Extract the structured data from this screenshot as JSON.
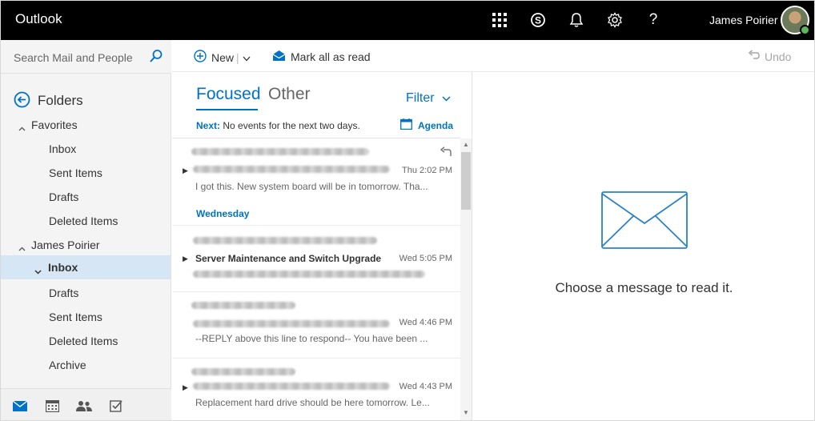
{
  "app": {
    "title": "Outlook"
  },
  "topbar": {
    "icons": [
      "app-launcher-icon",
      "skype-icon",
      "bell-icon",
      "gear-icon",
      "help-icon"
    ],
    "help_glyph": "?",
    "user_name": "James Poirier"
  },
  "search": {
    "placeholder": "Search Mail and People"
  },
  "folders": {
    "header": "Folders",
    "favorites": {
      "label": "Favorites",
      "items": [
        "Inbox",
        "Sent Items",
        "Drafts",
        "Deleted Items"
      ]
    },
    "account": {
      "label": "James Poirier",
      "items": [
        "Inbox",
        "Drafts",
        "Sent Items",
        "Deleted Items",
        "Archive"
      ],
      "selected": "Inbox"
    }
  },
  "bottom_nav": [
    "mail-icon",
    "calendar-icon",
    "people-icon",
    "tasks-icon"
  ],
  "commandbar": {
    "new_label": "New",
    "mark_read_label": "Mark all as read",
    "undo_label": "Undo"
  },
  "list": {
    "tabs": {
      "focused": "Focused",
      "other": "Other"
    },
    "filter_label": "Filter",
    "next_label": "Next:",
    "next_text": "No events for the next two days.",
    "agenda_label": "Agenda",
    "messages": [
      {
        "subject": "",
        "time": "Thu 2:02 PM",
        "preview": "I got this. New system board will be in tomorrow. Tha...",
        "replied": true
      },
      {
        "section": "Wednesday"
      },
      {
        "subject": "Server Maintenance and Switch Upgrade",
        "time": "Wed 5:05 PM",
        "preview": ""
      },
      {
        "subject": "",
        "time": "Wed 4:46 PM",
        "preview": "--REPLY above this line to respond-- You have been ..."
      },
      {
        "subject": "",
        "time": "Wed 4:43 PM",
        "preview": "Replacement hard drive should be here tomorrow. Le..."
      }
    ]
  },
  "reading_pane": {
    "empty_text": "Choose a message to read it."
  },
  "colors": {
    "accent": "#0072c6",
    "topbar": "#000000",
    "selected": "#d6e6f5"
  }
}
